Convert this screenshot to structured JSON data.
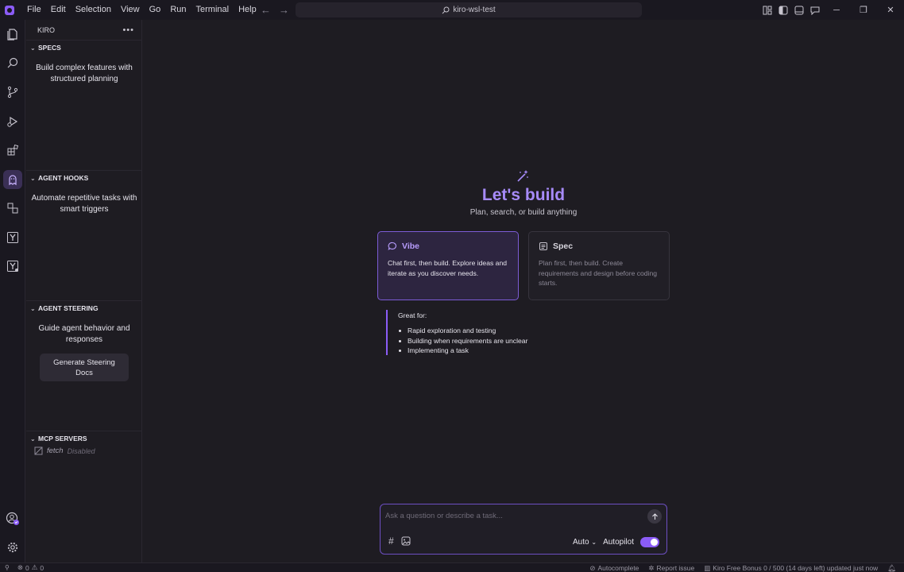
{
  "menu": [
    "File",
    "Edit",
    "Selection",
    "View",
    "Go",
    "Run",
    "Terminal",
    "Help"
  ],
  "search": {
    "label": "kiro-wsl-test"
  },
  "sidebar": {
    "title": "KIRO",
    "sections": {
      "specs": {
        "title": "SPECS",
        "desc": "Build complex features with structured planning"
      },
      "hooks": {
        "title": "AGENT HOOKS",
        "desc": "Automate repetitive tasks with smart triggers"
      },
      "steering": {
        "title": "AGENT STEERING",
        "desc": "Guide agent behavior and responses",
        "button": "Generate Steering Docs"
      },
      "mcp": {
        "title": "MCP SERVERS",
        "server_name": "fetch",
        "server_status": "Disabled"
      }
    }
  },
  "main": {
    "title": "Let's build",
    "subtitle": "Plan, search, or build anything",
    "vibe": {
      "title": "Vibe",
      "desc": "Chat first, then build. Explore ideas and iterate as you discover needs."
    },
    "spec": {
      "title": "Spec",
      "desc": "Plan first, then build. Create requirements and design before coding starts."
    },
    "great_for": {
      "title": "Great for:",
      "items": [
        "Rapid exploration and testing",
        "Building when requirements are unclear",
        "Implementing a task"
      ]
    },
    "chat": {
      "placeholder": "Ask a question or describe a task...",
      "mode": "Auto",
      "autopilot": "Autopilot",
      "autopilot_on": true
    }
  },
  "statusbar": {
    "errors": "0",
    "warnings": "0",
    "autocomplete": "Autocomplete",
    "report": "Report issue",
    "bonus": "Kiro Free Bonus 0 / 500 (14 days left) updated just now"
  },
  "colors": {
    "accent": "#8b5cf6",
    "accent_text": "#a78bfa",
    "background": "#1e1c22"
  }
}
